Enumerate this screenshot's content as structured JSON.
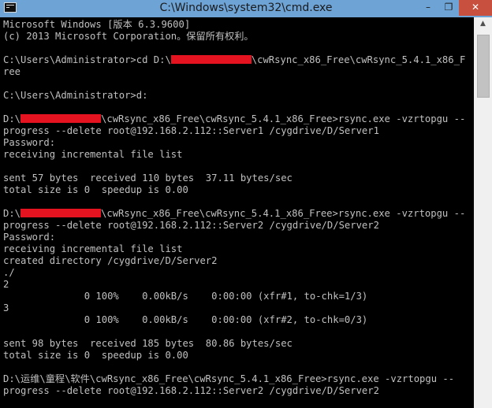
{
  "window": {
    "title": "C:\\Windows\\system32\\cmd.exe"
  },
  "caption": {
    "minimize": "–",
    "maximize": "❐",
    "close": "✕"
  },
  "scrollbar": {
    "up_arrow": "▲"
  },
  "console": {
    "lines": [
      "Microsoft Windows [版本 6.3.9600]",
      "(c) 2013 Microsoft Corporation。保留所有权利。",
      "",
      "C:\\Users\\Administrator>cd D:\\",
      "\\cwRsync_x86_Free\\cwRsync_5.4.1_x86_F",
      "ree",
      "",
      "C:\\Users\\Administrator>d:",
      "",
      "D:\\",
      "\\cwRsync_x86_Free\\cwRsync_5.4.1_x86_Free>rsync.exe -vzrtopgu --",
      "progress --delete root@192.168.2.112::Server1 /cygdrive/D/Server1",
      "Password:",
      "receiving incremental file list",
      "",
      "sent 57 bytes  received 110 bytes  37.11 bytes/sec",
      "total size is 0  speedup is 0.00",
      "",
      "D:\\",
      "\\cwRsync_x86_Free\\cwRsync_5.4.1_x86_Free>rsync.exe -vzrtopgu --",
      "progress --delete root@192.168.2.112::Server2 /cygdrive/D/Server2",
      "Password:",
      "receiving incremental file list",
      "created directory /cygdrive/D/Server2",
      "./",
      "2",
      "              0 100%    0.00kB/s    0:00:00 (xfr#1, to-chk=1/3)",
      "3",
      "              0 100%    0.00kB/s    0:00:00 (xfr#2, to-chk=0/3)",
      "",
      "sent 98 bytes  received 185 bytes  80.86 bytes/sec",
      "total size is 0  speedup is 0.00",
      "",
      "D:\\运维\\童程\\软件\\cwRsync_x86_Free\\cwRsync_5.4.1_x86_Free>rsync.exe -vzrtopgu --",
      "progress --delete root@192.168.2.112::Server2 /cygdrive/D/Server2"
    ]
  },
  "colors": {
    "redaction": "#e5121f",
    "console_text": "#c0c0c0",
    "console_bg": "#000000",
    "titlebar": "#6ea3d6",
    "close_button": "#c7503f"
  }
}
